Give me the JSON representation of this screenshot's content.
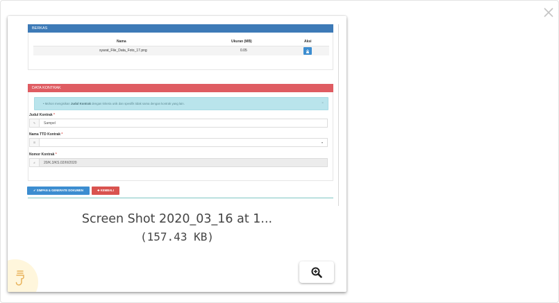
{
  "modal": {
    "close_icon": "close-icon"
  },
  "preview": {
    "berkas_panel": {
      "title": "BERKAS",
      "columns": [
        "Nama",
        "Ukuran (MB)",
        "Aksi"
      ],
      "rows": [
        {
          "nama": "syarat_File_Data_Foto_17.png",
          "ukuran": "0.05",
          "aksi_icon": "download-icon"
        }
      ]
    },
    "kontrak_panel": {
      "title": "DATA KONTRAK",
      "alert_prefix": "Mohon mengisikan",
      "alert_bold": "Judul Kontrak",
      "alert_suffix": "dengan kriteria unik dan spesifik tidak sama dengan kontrak yang lain.",
      "fields": {
        "judul_label": "Judul Kontrak",
        "judul_value": "Sampel",
        "ttd_label": "Nama TTD Kontrak",
        "ttd_value": "",
        "nomor_label": "Nomor Kontrak",
        "nomor_value": "20/K.3/KS.02/III/2020",
        "required_mark": "*"
      }
    },
    "buttons": {
      "save": "✔ SIMPAN & GENERATE DOKUMEN",
      "back": "✚ KEMBALI"
    }
  },
  "file": {
    "name": "Screen Shot 2020_03_16 at 1...",
    "size": "(157.43 KB)"
  },
  "actions": {
    "zoom_icon": "zoom-in-icon",
    "corner_icon": "stamp-icon"
  }
}
